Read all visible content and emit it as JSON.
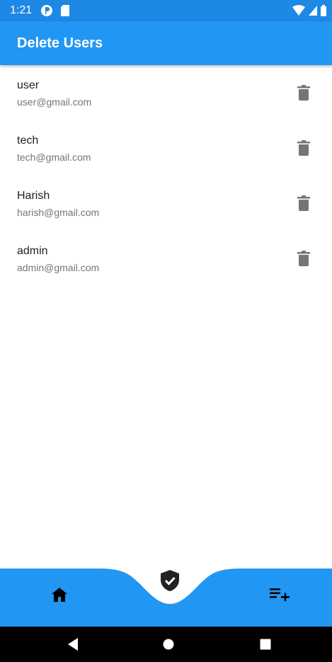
{
  "status_bar": {
    "time": "1:21",
    "icons": [
      "app-notification-icon",
      "sd-card-icon",
      "wifi-icon",
      "cell-signal-icon",
      "battery-icon"
    ]
  },
  "app_bar": {
    "title": "Delete Users"
  },
  "users": [
    {
      "name": "user",
      "email": "user@gmail.com"
    },
    {
      "name": "tech",
      "email": "tech@gmail.com"
    },
    {
      "name": "Harish",
      "email": "harish@gmail.com"
    },
    {
      "name": "admin",
      "email": "admin@gmail.com"
    }
  ],
  "bottom_nav": {
    "items": [
      "home-icon",
      "verified-icon",
      "playlist-add-icon"
    ],
    "selected": "verified-icon"
  },
  "system_nav": [
    "back-icon",
    "home-circle-icon",
    "recents-icon"
  ],
  "colors": {
    "status_bar": "#1e88e5",
    "primary": "#2196f3",
    "text_primary": "#212121",
    "text_secondary": "#757575",
    "delete_icon": "#757575"
  }
}
